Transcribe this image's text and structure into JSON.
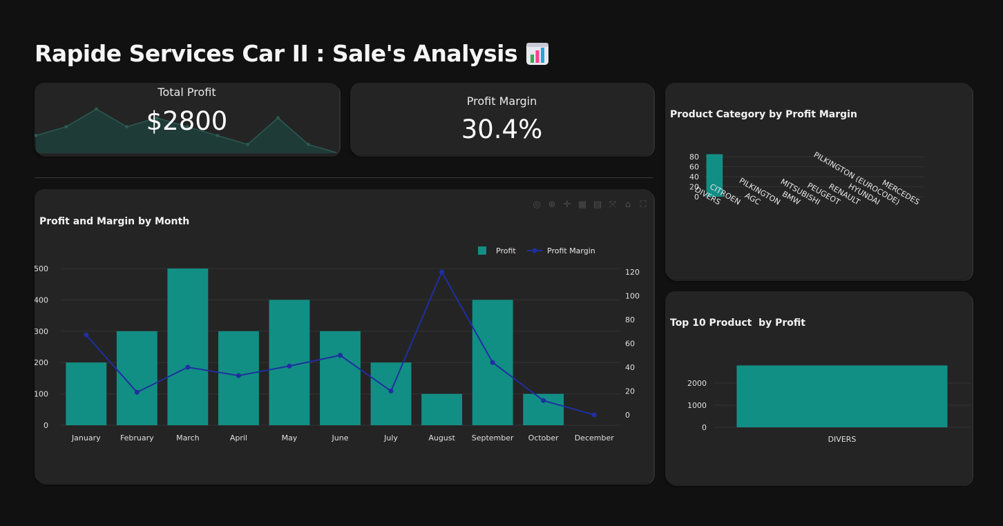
{
  "header": {
    "title": "Rapide Services Car II : Sale's Analysis",
    "title_icon": "bar-chart-emoji-icon"
  },
  "kpis": {
    "total_profit": {
      "label": "Total Profit",
      "value": "$2800",
      "sparkline": [
        200,
        300,
        500,
        300,
        400,
        300,
        200,
        100,
        400,
        100,
        0
      ]
    },
    "profit_margin": {
      "label": "Profit Margin",
      "value": "30.4%"
    }
  },
  "colors": {
    "background": "#111111",
    "card": "#242424",
    "bar": "#128f85",
    "line": "#1f2fa0",
    "sparkline_fill": "#1f3b37",
    "sparkline_line": "#2a5a52"
  },
  "modebar_icons": [
    "camera-icon",
    "zoom-icon",
    "pan-icon",
    "box-select-icon",
    "lasso-icon",
    "autoscale-icon",
    "home-icon",
    "fullscreen-icon"
  ],
  "chart_data": [
    {
      "id": "profit_margin_by_month",
      "type": "bar",
      "title": "Profit and Margin by Month",
      "categories": [
        "January",
        "February",
        "March",
        "April",
        "May",
        "June",
        "July",
        "August",
        "September",
        "October",
        "December"
      ],
      "series": [
        {
          "name": "Profit",
          "type": "bar",
          "axis": "left",
          "values": [
            200,
            300,
            500,
            300,
            400,
            300,
            200,
            100,
            400,
            100,
            0
          ]
        },
        {
          "name": "Profit Margin",
          "type": "line",
          "axis": "right",
          "values": [
            67,
            19,
            40,
            33,
            41,
            50,
            20,
            120,
            44,
            12,
            0
          ]
        }
      ],
      "y_ticks": [
        "0",
        "100",
        "200",
        "300",
        "400",
        "500"
      ],
      "y2_ticks": [
        "0",
        "20",
        "40",
        "60",
        "80",
        "100",
        "120"
      ],
      "ylim": [
        0,
        500
      ],
      "y2lim": [
        0,
        120
      ],
      "grid": true,
      "legend": "top-right"
    },
    {
      "id": "category_by_margin",
      "type": "bar",
      "title": "Product Category by Profit Margin",
      "categories": [
        "DIVERS",
        "CITROEN",
        "AGC",
        "PILKINGTON",
        "BMW",
        "MITSUBISHI",
        "PEUGEOT",
        "RENAULT",
        "HYUNDAI",
        "PILKINGTON (EUROCODE)",
        "MERCEDES"
      ],
      "values": [
        85,
        0,
        0,
        0,
        0,
        0,
        0,
        0,
        0,
        0,
        0
      ],
      "y_ticks": [
        "0",
        "20",
        "40",
        "60",
        "80"
      ],
      "ylim": [
        0,
        80
      ],
      "grid": true
    },
    {
      "id": "top10_product_profit",
      "type": "bar",
      "title": "Top 10 Product  by Profit",
      "categories": [
        "DIVERS"
      ],
      "values": [
        2800
      ],
      "y_ticks": [
        "0",
        "1000",
        "2000"
      ],
      "ylim": [
        0,
        2000
      ],
      "grid": true
    }
  ]
}
